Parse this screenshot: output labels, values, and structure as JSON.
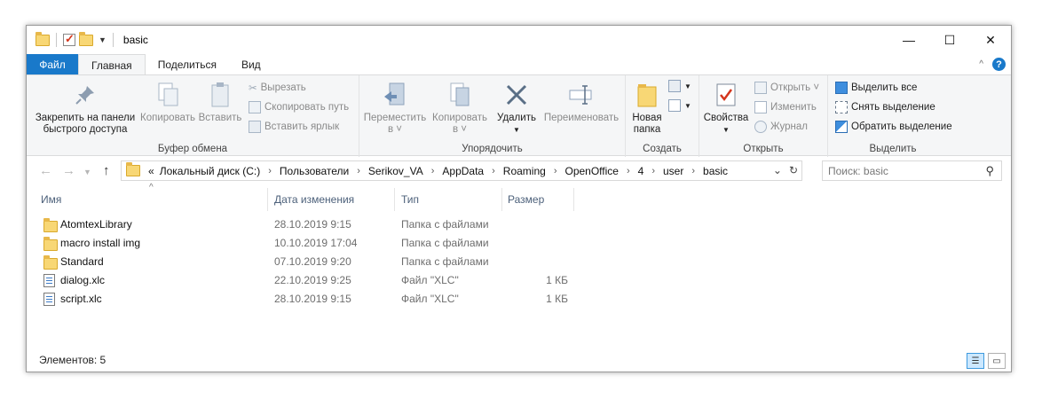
{
  "window": {
    "title": "basic",
    "controls": {
      "minimize": "—",
      "maximize": "☐",
      "close": "✕"
    }
  },
  "tabs": {
    "file": "Файл",
    "items": [
      "Главная",
      "Поделиться",
      "Вид"
    ],
    "active": "Главная",
    "help": "?"
  },
  "ribbon": {
    "clipboard": {
      "pin_label": "Закрепить на панели быстрого доступа",
      "pin_line1": "Закрепить на панели",
      "pin_line2": "быстрого доступа",
      "copy": "Копировать",
      "paste": "Вставить",
      "cut": "Вырезать",
      "copy_path": "Скопировать путь",
      "paste_shortcut": "Вставить ярлык",
      "label": "Буфер обмена"
    },
    "organize": {
      "move_line1": "Переместить",
      "move_line2": "в ˅",
      "copy_line1": "Копировать",
      "copy_line2": "в ˅",
      "delete": "Удалить",
      "rename": "Переименовать",
      "label": "Упорядочить"
    },
    "create": {
      "new_line1": "Новая",
      "new_line2": "папка",
      "label": "Создать"
    },
    "open": {
      "properties": "Свойства",
      "open": "Открыть ˅",
      "edit": "Изменить",
      "history": "Журнал",
      "label": "Открыть"
    },
    "select": {
      "select_all": "Выделить все",
      "select_none": "Снять выделение",
      "invert": "Обратить выделение",
      "label": "Выделить"
    }
  },
  "address": {
    "prefix": "«",
    "crumbs": [
      "Локальный диск (C:)",
      "Пользователи",
      "Serikov_VA",
      "AppData",
      "Roaming",
      "OpenOffice",
      "4",
      "user",
      "basic"
    ],
    "search_placeholder": "Поиск: basic"
  },
  "columns": {
    "name": "Имя",
    "date": "Дата изменения",
    "type": "Тип",
    "size": "Размер"
  },
  "files": [
    {
      "name": "AtomtexLibrary",
      "date": "28.10.2019 9:15",
      "type": "Папка с файлами",
      "size": "",
      "kind": "folder"
    },
    {
      "name": "macro install img",
      "date": "10.10.2019 17:04",
      "type": "Папка с файлами",
      "size": "",
      "kind": "folder"
    },
    {
      "name": "Standard",
      "date": "07.10.2019 9:20",
      "type": "Папка с файлами",
      "size": "",
      "kind": "folder"
    },
    {
      "name": "dialog.xlc",
      "date": "22.10.2019 9:25",
      "type": "Файл \"XLC\"",
      "size": "1 КБ",
      "kind": "file"
    },
    {
      "name": "script.xlc",
      "date": "28.10.2019 9:15",
      "type": "Файл \"XLC\"",
      "size": "1 КБ",
      "kind": "file"
    }
  ],
  "status": {
    "items_count": "Элементов: 5"
  },
  "colors": {
    "accent": "#1979ca",
    "folder": "#f8d775",
    "ribbon_bg": "#f5f6f7"
  }
}
